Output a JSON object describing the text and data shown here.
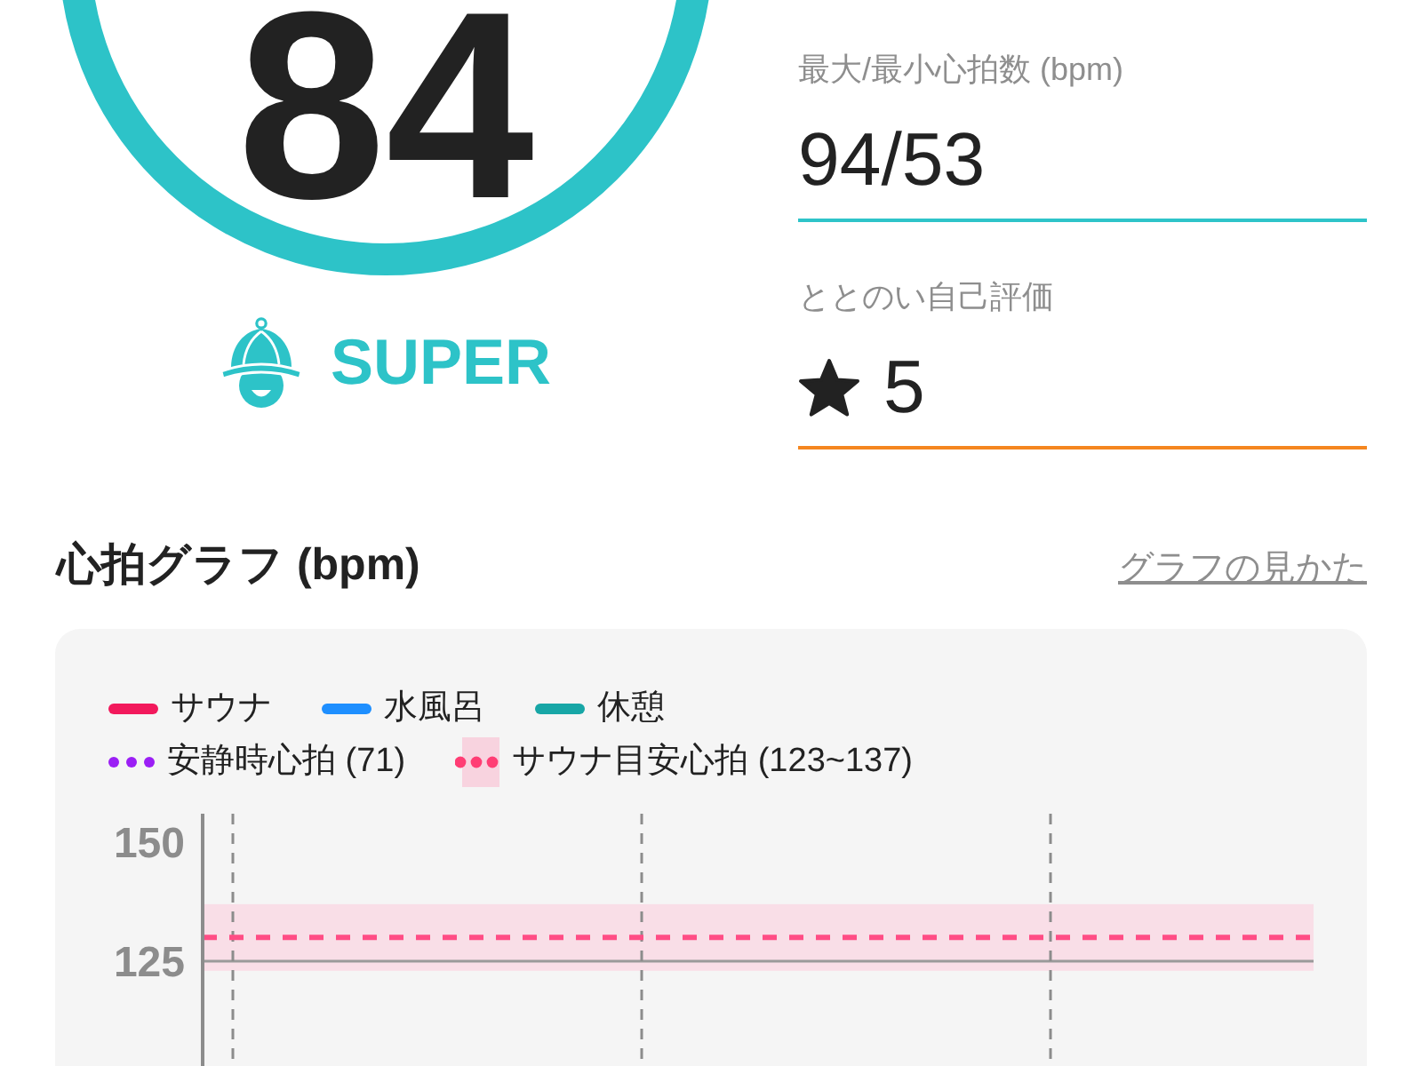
{
  "score": {
    "value": "84",
    "rank": "SUPER"
  },
  "stats": [
    {
      "label": "最大/最小心拍数 (bpm)",
      "value": "94/53",
      "kind": "number",
      "color": "#2ec4c9"
    },
    {
      "label": "ととのい自己評価",
      "value": "5",
      "kind": "rating",
      "color": "#f5861f"
    }
  ],
  "heart_rate_graph": {
    "title": "心拍グラフ (bpm)",
    "help_link": "グラフの見かた",
    "legend": [
      [
        {
          "label": "サウナ",
          "kind": "line",
          "color": "#f2195c"
        },
        {
          "label": "水風呂",
          "kind": "line",
          "color": "#1e8fff"
        },
        {
          "label": "休憩",
          "kind": "line",
          "color": "#17a6a6"
        }
      ],
      [
        {
          "label": "安静時心拍 (71)",
          "kind": "dotted",
          "color": "#9b1ff5"
        },
        {
          "label": "サウナ目安心拍 (123~137)",
          "kind": "band",
          "color": "#ff3d74",
          "band": {
            "color": "#f8d3df"
          }
        }
      ]
    ],
    "chart_data": {
      "type": "line",
      "categories": [
        null,
        null,
        null
      ],
      "ylim": [
        103,
        156
      ],
      "yticks": [
        {
          "value": 150,
          "label": "150"
        },
        {
          "value": 125,
          "label": "125"
        }
      ],
      "bands": [
        {
          "axis": "y",
          "from": 123,
          "to": 137,
          "color": "#f9dee7"
        }
      ],
      "ref_lines": [
        {
          "axis": "y",
          "value": 130,
          "color": "#ff4d85"
        }
      ]
    }
  }
}
